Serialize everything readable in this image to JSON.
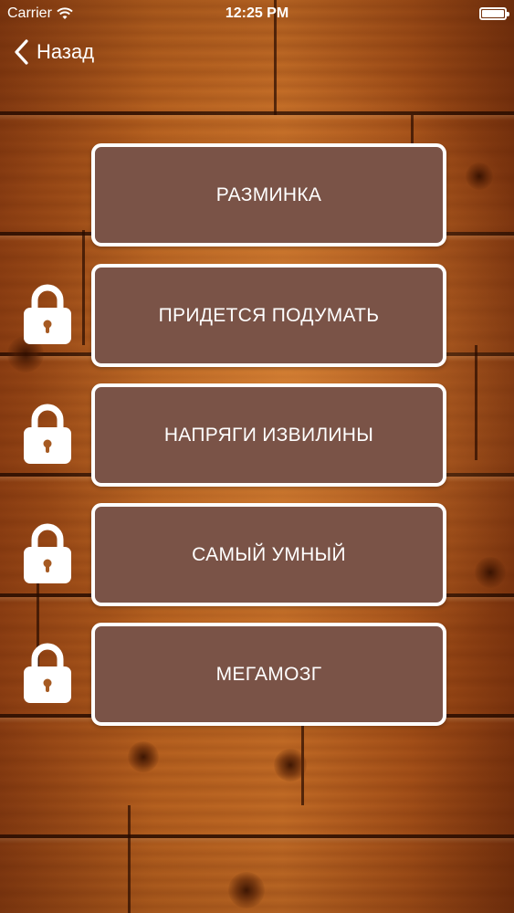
{
  "status_bar": {
    "carrier": "Carrier",
    "time": "12:25 PM",
    "battery_level": 1.0
  },
  "nav": {
    "back_label": "Назад"
  },
  "levels": [
    {
      "label": "РАЗМИНКА",
      "locked": false
    },
    {
      "label": "ПРИДЕТСЯ ПОДУМАТЬ",
      "locked": true
    },
    {
      "label": "НАПРЯГИ ИЗВИЛИНЫ",
      "locked": true
    },
    {
      "label": "САМЫЙ УМНЫЙ",
      "locked": true
    },
    {
      "label": "МЕГАМОЗГ",
      "locked": true
    }
  ],
  "colors": {
    "button_fill": "#7a5347",
    "button_border": "#ffffff",
    "text": "#ffffff"
  }
}
